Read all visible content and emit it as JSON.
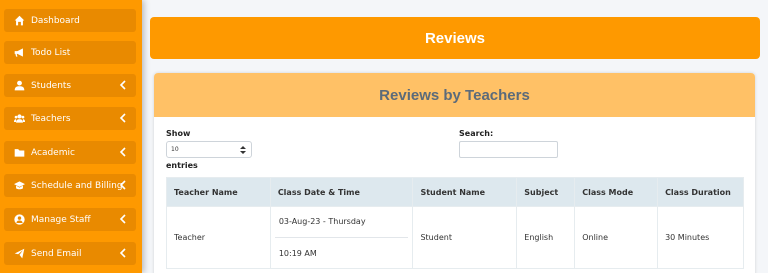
{
  "sidebar": {
    "items": [
      {
        "label": "Dashboard",
        "icon": "home-icon",
        "has_chevron": false
      },
      {
        "label": "Todo List",
        "icon": "megaphone-icon",
        "has_chevron": false
      },
      {
        "label": "Students",
        "icon": "user-icon",
        "has_chevron": true
      },
      {
        "label": "Teachers",
        "icon": "users-icon",
        "has_chevron": true
      },
      {
        "label": "Academic",
        "icon": "folder-icon",
        "has_chevron": true
      },
      {
        "label": "Schedule and Billing",
        "icon": "graduation-cap-icon",
        "has_chevron": true
      },
      {
        "label": "Manage Staff",
        "icon": "user-circle-icon",
        "has_chevron": true
      },
      {
        "label": "Send Email",
        "icon": "paper-plane-icon",
        "has_chevron": true
      }
    ]
  },
  "header": {
    "title": "Reviews"
  },
  "card": {
    "title": "Reviews by Teachers",
    "show_label": "Show",
    "show_value": "10",
    "entries_label": "entries",
    "search_label": "Search:",
    "search_value": ""
  },
  "table": {
    "columns": [
      "Teacher Name",
      "Class Date & Time",
      "Student Name",
      "Subject",
      "Class Mode",
      "Class Duration"
    ],
    "rows": [
      {
        "teacher": "Teacher",
        "date": "03-Aug-23 - Thursday",
        "time": "10:19 AM",
        "student": "Student",
        "subject": "English",
        "mode": "Online",
        "duration": "30 Minutes"
      }
    ]
  },
  "colors": {
    "accent": "#fe9900",
    "sidebar_item": "#e98a00",
    "card_header": "#ffc166",
    "table_header": "#dde8ee"
  }
}
